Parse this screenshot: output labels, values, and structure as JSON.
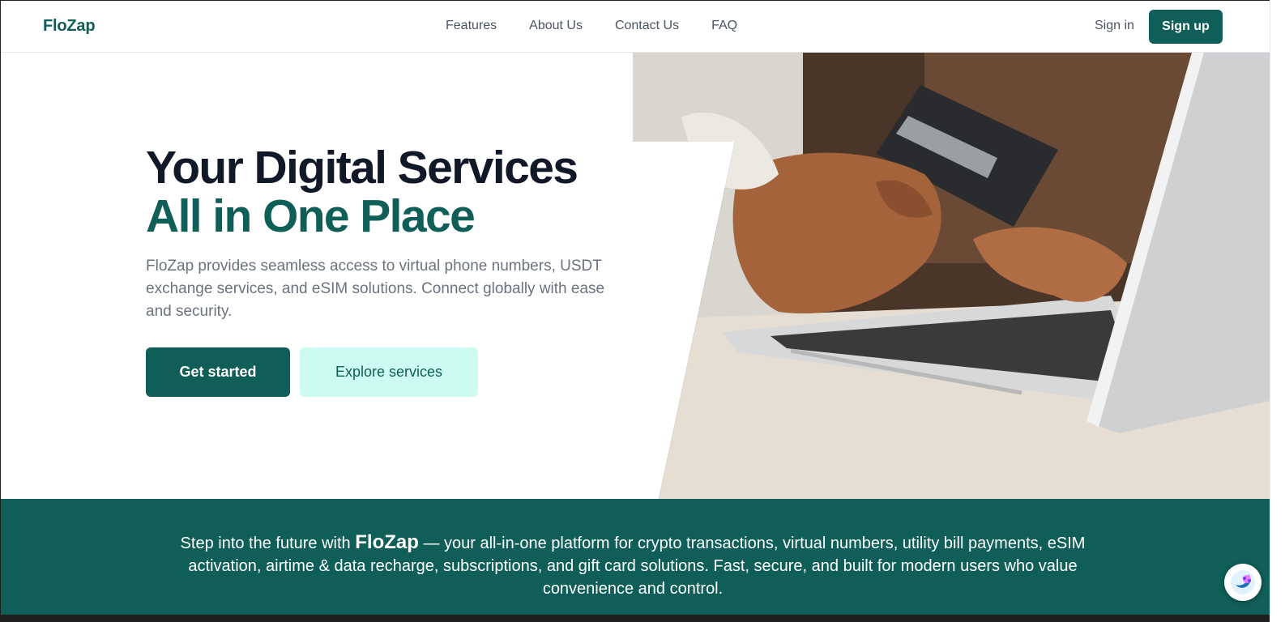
{
  "brand": "FloZap",
  "nav": {
    "links": [
      "Features",
      "About Us",
      "Contact Us",
      "FAQ"
    ],
    "signin": "Sign in",
    "signup": "Sign up"
  },
  "hero": {
    "title_line1": "Your Digital Services",
    "title_line2": "All in One Place",
    "description": "FloZap provides seamless access to virtual phone numbers, USDT exchange services, and eSIM solutions. Connect globally with ease and security.",
    "primary_cta": "Get started",
    "secondary_cta": "Explore services",
    "image_icon": "hands-credit-card-laptop-photo"
  },
  "banner": {
    "prefix": "Step into the future with",
    "brand": "FloZap",
    "suffix": "— your all-in-one platform for crypto transactions, virtual numbers, utility bill payments, eSIM activation, airtime & data recharge, subscriptions, and gift card solutions. Fast, secure, and built for modern users who value convenience and control."
  },
  "widget": {
    "icon": "assistant-brain-icon"
  },
  "colors": {
    "brand": "#0f5e57",
    "heading": "#111827",
    "muted": "#6b7280",
    "secondary_bg": "#ccfbf1"
  }
}
